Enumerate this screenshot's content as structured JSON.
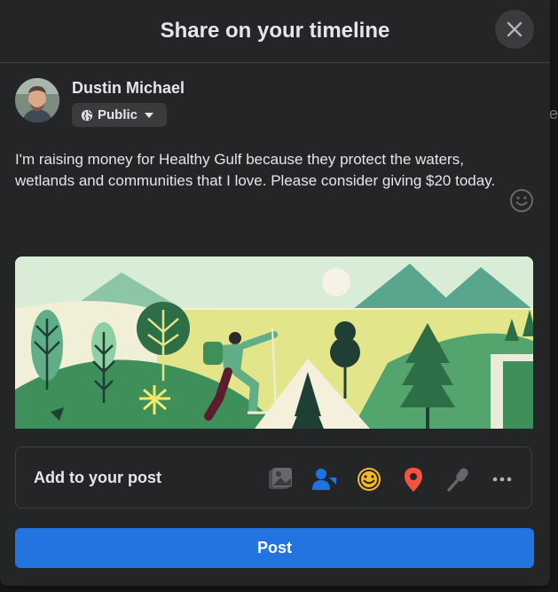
{
  "dialog": {
    "title": "Share on your timeline"
  },
  "user": {
    "name": "Dustin Michael",
    "audience": "Public"
  },
  "post": {
    "text": "I'm raising money for Healthy Gulf because they protect the waters, wetlands and communities that I love. Please consider giving $20 today."
  },
  "add_to_post": {
    "label": "Add to your post",
    "icons": [
      "photo-video-icon",
      "tag-people-icon",
      "feeling-icon",
      "check-in-icon",
      "live-audio-icon",
      "more-icon"
    ]
  },
  "actions": {
    "post_label": "Post"
  },
  "colors": {
    "modal_bg": "#242526",
    "primary_button": "#2374e1",
    "tag_icon": "#1b74e4",
    "feeling_icon": "#f7b928",
    "checkin_icon": "#f5533d",
    "muted_icon": "#65676b"
  }
}
